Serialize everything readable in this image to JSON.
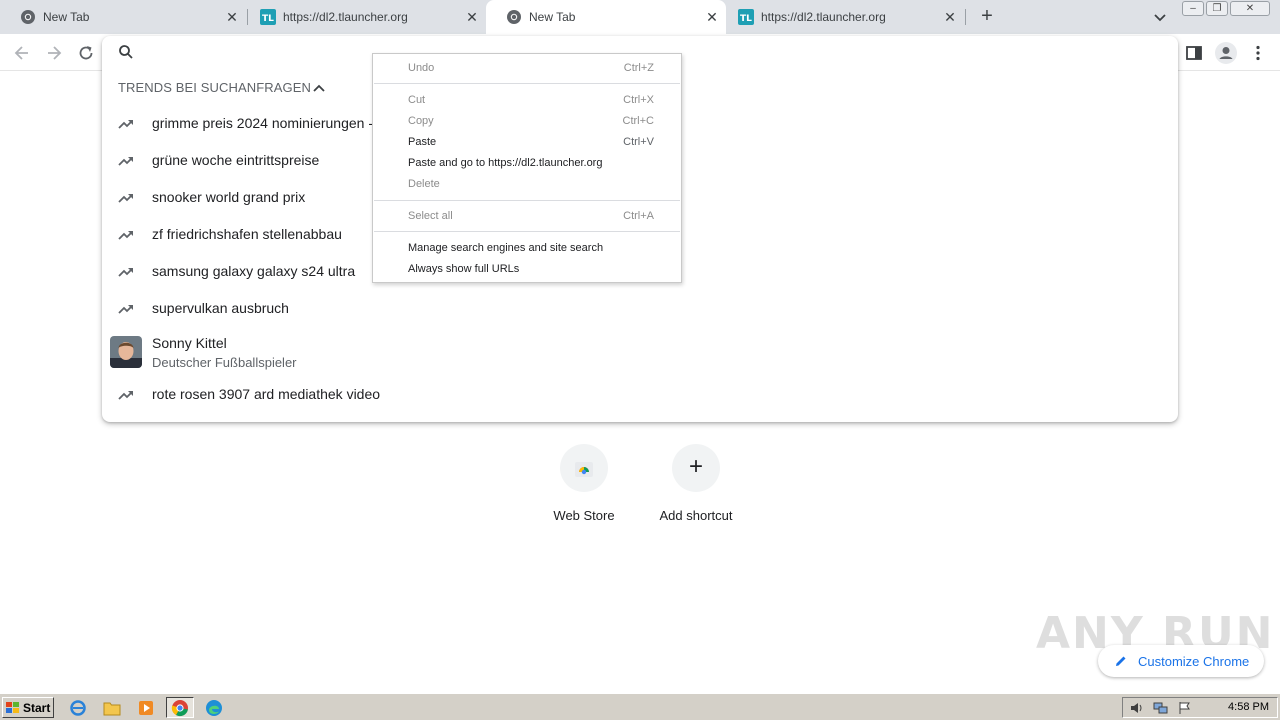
{
  "tabs": [
    {
      "title": "New Tab",
      "favicon": "chrome-icon",
      "active": false
    },
    {
      "title": "https://dl2.tlauncher.org",
      "favicon": "tlauncher-icon",
      "active": false
    },
    {
      "title": "New Tab",
      "favicon": "chrome-icon",
      "active": true
    },
    {
      "title": "https://dl2.tlauncher.org",
      "favicon": "tlauncher-icon",
      "active": false
    }
  ],
  "tab_close_glyph": "✕",
  "new_tab_glyph": "+",
  "window_controls": {
    "minimize": "‒",
    "restore": "❐",
    "close": "✕"
  },
  "omnibox": {
    "value": "",
    "trends_header": "TRENDS BEI SUCHANFRAGEN",
    "suggestions": [
      "grimme preis 2024 nominierungen -",
      "grüne woche eintrittspreise",
      "snooker world grand prix",
      "zf friedrichshafen stellenabbau",
      "samsung galaxy galaxy s24 ultra",
      "supervulkan ausbruch"
    ],
    "entity": {
      "name": "Sonny Kittel",
      "description": "Deutscher Fußballspieler"
    },
    "last_suggestion": "rote rosen 3907 ard mediathek video"
  },
  "context_menu": {
    "undo": {
      "label": "Undo",
      "shortcut": "Ctrl+Z"
    },
    "cut": {
      "label": "Cut",
      "shortcut": "Ctrl+X"
    },
    "copy": {
      "label": "Copy",
      "shortcut": "Ctrl+C"
    },
    "paste": {
      "label": "Paste",
      "shortcut": "Ctrl+V"
    },
    "paste_go": {
      "label": "Paste and go to https://dl2.tlauncher.org"
    },
    "delete": {
      "label": "Delete"
    },
    "select_all": {
      "label": "Select all",
      "shortcut": "Ctrl+A"
    },
    "manage": {
      "label": "Manage search engines and site search"
    },
    "full_urls": {
      "label": "Always show full URLs"
    }
  },
  "shortcuts": [
    {
      "label": "Web Store",
      "icon": "web-store-icon"
    },
    {
      "label": "Add shortcut",
      "icon": "plus-icon",
      "glyph": "+"
    }
  ],
  "customize_label": "Customize Chrome",
  "watermark": "ANY RUN",
  "taskbar": {
    "start_label": "Start",
    "clock": "4:58 PM"
  },
  "colors": {
    "accent_blue": "#1a73e8",
    "tab_strip": "#dee1e6",
    "taskbar": "#d4d0c8"
  }
}
